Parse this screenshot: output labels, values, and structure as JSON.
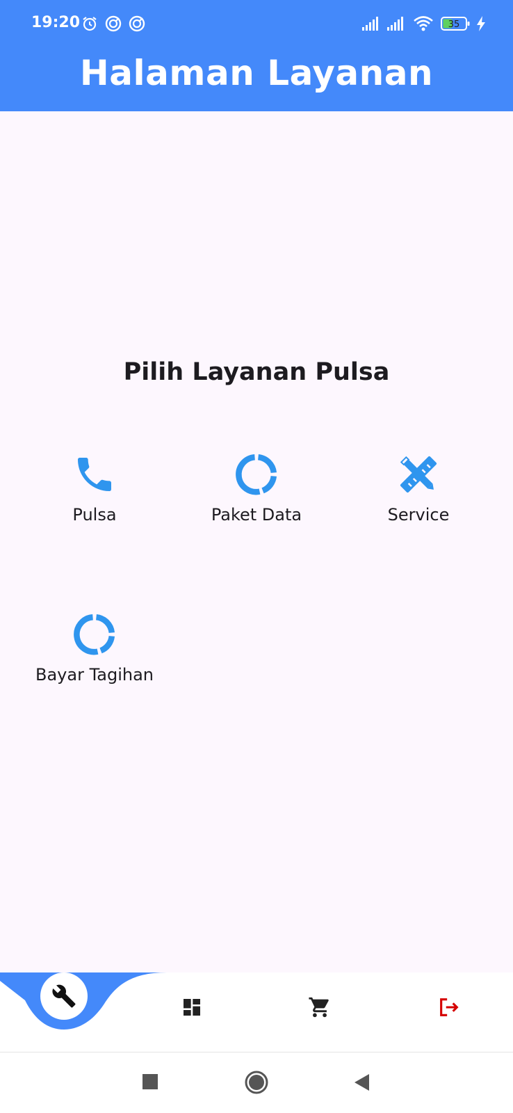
{
  "status_bar": {
    "time": "19:20",
    "battery": "35",
    "icons": [
      "alarm-icon",
      "sync-icon",
      "sync-icon",
      "signal-icon",
      "signal-icon",
      "wifi-icon",
      "battery-icon",
      "charging-icon"
    ]
  },
  "app_bar": {
    "title": "Halaman Layanan",
    "color": "#4489fa"
  },
  "main": {
    "heading": "Pilih Layanan Pulsa",
    "services": [
      {
        "label": "Pulsa",
        "icon": "phone-icon"
      },
      {
        "label": "Paket Data",
        "icon": "data-ring-icon"
      },
      {
        "label": "Service",
        "icon": "tools-icon"
      },
      {
        "label": "Bayar Tagihan",
        "icon": "data-ring-icon"
      }
    ],
    "icon_color": "#2f95ee"
  },
  "bottom_nav": {
    "items": [
      {
        "icon": "wrench-icon",
        "active": true
      },
      {
        "icon": "dashboard-icon",
        "active": false
      },
      {
        "icon": "cart-icon",
        "active": false
      },
      {
        "icon": "logout-icon",
        "active": false,
        "color": "#d50000"
      }
    ]
  },
  "system_nav": {
    "buttons": [
      "recents-button",
      "home-button",
      "back-button"
    ]
  }
}
